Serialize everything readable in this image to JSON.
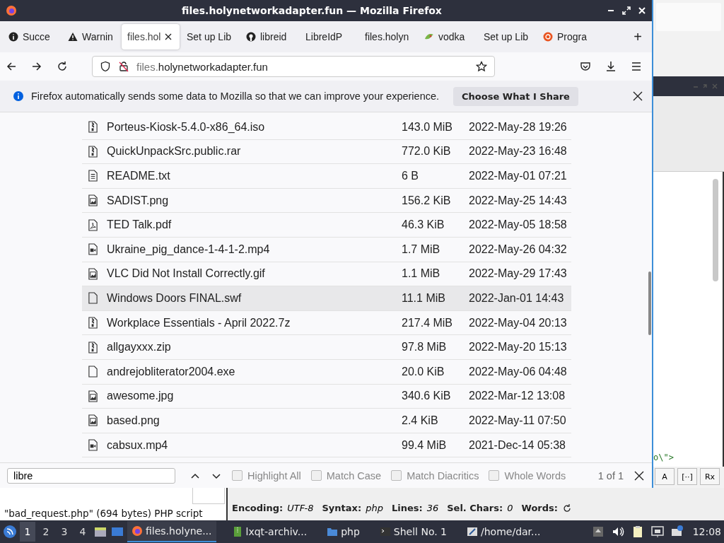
{
  "window": {
    "title": "files.holynetworkadapter.fun — Mozilla Firefox"
  },
  "tabs": [
    {
      "label": "Succe",
      "kind": "info",
      "selected": false
    },
    {
      "label": "Warnin",
      "kind": "warning",
      "selected": false
    },
    {
      "label": "files.hol",
      "kind": "plain",
      "selected": true
    },
    {
      "label": "Set up Lib",
      "kind": "plain",
      "selected": false
    },
    {
      "label": "libreid",
      "kind": "github",
      "selected": false
    },
    {
      "label": "LibreIdP",
      "kind": "plain",
      "selected": false
    },
    {
      "label": "files.holyn",
      "kind": "plain",
      "selected": false
    },
    {
      "label": "vodka",
      "kind": "leaf",
      "selected": false
    },
    {
      "label": "Set up Lib",
      "kind": "plain",
      "selected": false
    },
    {
      "label": "Progra",
      "kind": "circle",
      "selected": false
    }
  ],
  "new_tab": "+",
  "url": {
    "host_prefix": "files.",
    "domain": "holynetworkadapter.fun"
  },
  "notification": {
    "text": "Firefox automatically sends some data to Mozilla so that we can improve your experience.",
    "button": "Choose What I Share"
  },
  "files": [
    {
      "name": "Porteus-Kiosk-5.4.0-x86_64.iso",
      "size": "143.0 MiB",
      "date": "2022-May-28 19:26",
      "kind": "archive",
      "selected": false
    },
    {
      "name": "QuickUnpackSrc.public.rar",
      "size": "772.0 KiB",
      "date": "2022-May-23 16:48",
      "kind": "archive",
      "selected": false
    },
    {
      "name": "README.txt",
      "size": "6 B",
      "date": "2022-May-01 07:21",
      "kind": "text",
      "selected": false
    },
    {
      "name": "SADIST.png",
      "size": "156.2 KiB",
      "date": "2022-May-25 14:43",
      "kind": "image",
      "selected": false
    },
    {
      "name": "TED Talk.pdf",
      "size": "46.3 KiB",
      "date": "2022-May-05 18:58",
      "kind": "pdf",
      "selected": false
    },
    {
      "name": "Ukraine_pig_dance-1-4-1-2.mp4",
      "size": "1.7 MiB",
      "date": "2022-May-26 04:32",
      "kind": "video",
      "selected": false
    },
    {
      "name": "VLC Did Not Install Correctly.gif",
      "size": "1.1 MiB",
      "date": "2022-May-29 17:43",
      "kind": "image",
      "selected": false
    },
    {
      "name": "Windows Doors FINAL.swf",
      "size": "11.1 MiB",
      "date": "2022-Jan-01 14:43",
      "kind": "file",
      "selected": true
    },
    {
      "name": "Workplace Essentials - April 2022.7z",
      "size": "217.4 MiB",
      "date": "2022-May-04 20:13",
      "kind": "archive",
      "selected": false
    },
    {
      "name": "allgayxxx.zip",
      "size": "97.8 MiB",
      "date": "2022-May-20 15:13",
      "kind": "archive",
      "selected": false
    },
    {
      "name": "andrejobliterator2004.exe",
      "size": "20.0 KiB",
      "date": "2022-May-06 04:48",
      "kind": "file",
      "selected": false
    },
    {
      "name": "awesome.jpg",
      "size": "340.6 KiB",
      "date": "2022-Mar-12 13:08",
      "kind": "image",
      "selected": false
    },
    {
      "name": "based.png",
      "size": "2.4 KiB",
      "date": "2022-May-11 07:50",
      "kind": "image",
      "selected": false
    },
    {
      "name": "cabsux.mp4",
      "size": "99.4 MiB",
      "date": "2021-Dec-14 05:38",
      "kind": "video",
      "selected": false
    }
  ],
  "find_bar": {
    "value": "libre",
    "options": [
      {
        "label": "Highlight All",
        "checked": false
      },
      {
        "label": "Match Case",
        "checked": false
      },
      {
        "label": "Match Diacritics",
        "checked": false
      },
      {
        "label": "Whole Words",
        "checked": false
      }
    ],
    "result": "1 of 1"
  },
  "background_editor": {
    "code": "o\\\">",
    "buttons": [
      "A",
      "[··]",
      "Rx"
    ]
  },
  "status_text": "\"bad_request.php\" (694 bytes) PHP script",
  "editor_status": [
    {
      "label": "Encoding:",
      "value": "UTF-8"
    },
    {
      "label": "Syntax:",
      "value": "php"
    },
    {
      "label": "Lines:",
      "value": "36"
    },
    {
      "label": "Sel. Chars:",
      "value": "0"
    },
    {
      "label": "Words:"
    }
  ],
  "taskbar": {
    "desktops": [
      {
        "label": "1",
        "selected": true
      },
      {
        "label": "2",
        "selected": false
      },
      {
        "label": "3",
        "selected": false
      },
      {
        "label": "4",
        "selected": false
      }
    ],
    "tasks": [
      {
        "label": "files.holyne...",
        "kind": "firefox",
        "selected": true
      },
      {
        "label": "lxqt-archiv...",
        "kind": "archive",
        "selected": false
      },
      {
        "label": "php",
        "kind": "folder",
        "selected": false
      },
      {
        "label": "Shell No. 1",
        "kind": "terminal",
        "selected": false
      },
      {
        "label": "/home/dar...",
        "kind": "editor",
        "selected": false
      }
    ],
    "clock": "12:08"
  }
}
